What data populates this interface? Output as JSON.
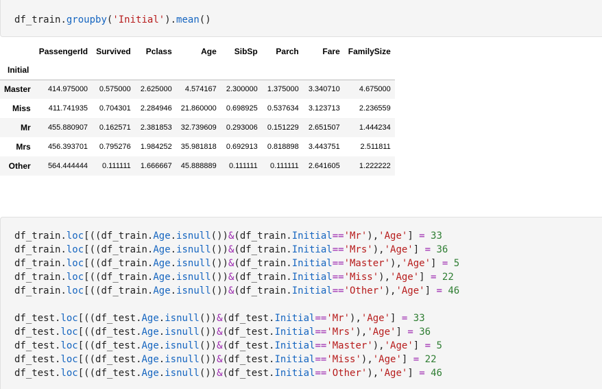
{
  "cell1": {
    "code": [
      {
        "t": "df_train",
        "c": "tok-name"
      },
      {
        "t": ".",
        "c": "tok-punc"
      },
      {
        "t": "groupby",
        "c": "tok-attr"
      },
      {
        "t": "(",
        "c": "tok-punc"
      },
      {
        "t": "'Initial'",
        "c": "tok-str"
      },
      {
        "t": ").",
        "c": "tok-punc"
      },
      {
        "t": "mean",
        "c": "tok-attr"
      },
      {
        "t": "()",
        "c": "tok-punc"
      }
    ]
  },
  "output_table": {
    "columns": [
      "PassengerId",
      "Survived",
      "Pclass",
      "Age",
      "SibSp",
      "Parch",
      "Fare",
      "FamilySize"
    ],
    "index_name": "Initial",
    "rows": [
      {
        "index": "Master",
        "values": [
          "414.975000",
          "0.575000",
          "2.625000",
          "4.574167",
          "2.300000",
          "1.375000",
          "3.340710",
          "4.675000"
        ]
      },
      {
        "index": "Miss",
        "values": [
          "411.741935",
          "0.704301",
          "2.284946",
          "21.860000",
          "0.698925",
          "0.537634",
          "3.123713",
          "2.236559"
        ]
      },
      {
        "index": "Mr",
        "values": [
          "455.880907",
          "0.162571",
          "2.381853",
          "32.739609",
          "0.293006",
          "0.151229",
          "2.651507",
          "1.444234"
        ]
      },
      {
        "index": "Mrs",
        "values": [
          "456.393701",
          "0.795276",
          "1.984252",
          "35.981818",
          "0.692913",
          "0.818898",
          "3.443751",
          "2.511811"
        ]
      },
      {
        "index": "Other",
        "values": [
          "564.444444",
          "0.111111",
          "1.666667",
          "45.888889",
          "0.111111",
          "0.111111",
          "2.641605",
          "1.222222"
        ]
      }
    ]
  },
  "cell2": {
    "blocks": [
      {
        "df": "df_train",
        "lines": [
          {
            "initial": "'Mr'",
            "age": "33"
          },
          {
            "initial": "'Mrs'",
            "age": "36"
          },
          {
            "initial": "'Master'",
            "age": "5"
          },
          {
            "initial": "'Miss'",
            "age": "22"
          },
          {
            "initial": "'Other'",
            "age": "46"
          }
        ]
      },
      {
        "df": "df_test",
        "lines": [
          {
            "initial": "'Mr'",
            "age": "33"
          },
          {
            "initial": "'Mrs'",
            "age": "36"
          },
          {
            "initial": "'Master'",
            "age": "5"
          },
          {
            "initial": "'Miss'",
            "age": "22"
          },
          {
            "initial": "'Other'",
            "age": "46"
          }
        ]
      }
    ],
    "tokens": {
      "loc": "loc",
      "age_attr": "Age",
      "isnull": "isnull",
      "initial_attr": "Initial",
      "age_key": "'Age'",
      "eq_op": "==",
      "and_op": "&",
      "assign": "="
    }
  },
  "colors": {
    "cell_bg": "#f5f5f5",
    "attribute": "#1565c0",
    "string": "#b71c1c",
    "operator": "#9c27b0",
    "number": "#2e7d32"
  }
}
